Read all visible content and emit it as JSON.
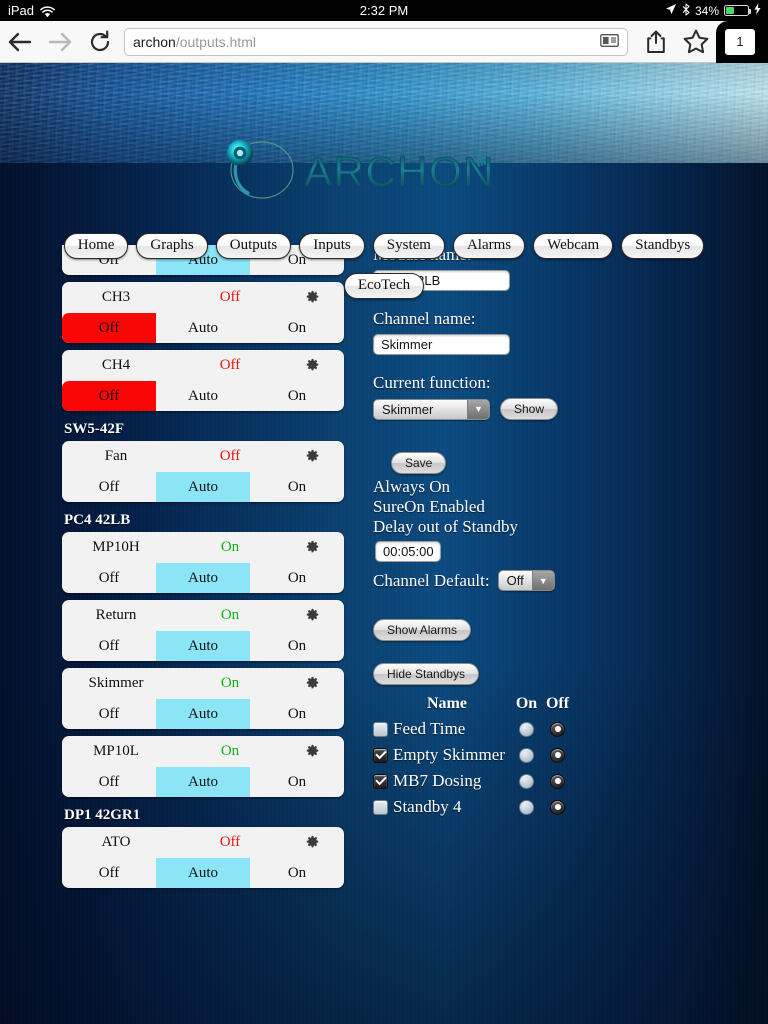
{
  "status_bar": {
    "carrier": "iPad",
    "wifi_icon": "wifi-icon",
    "time": "2:32 PM",
    "location_icon": "location-arrow-icon",
    "bluetooth_icon": "bluetooth-icon",
    "battery_percent": "34%",
    "charging_icon": "lightning-bolt-icon"
  },
  "browser": {
    "back_icon": "back-arrow-icon",
    "forward_icon": "forward-arrow-icon",
    "reload_icon": "reload-icon",
    "url_host": "archon",
    "url_path": "/outputs.html",
    "reader_icon": "reader-view-icon",
    "share_icon": "share-icon",
    "bookmark_icon": "star-icon",
    "tab_count": "1"
  },
  "header": {
    "logo_text": "ARCHON",
    "logo_mark": "archon-circle-logo-icon",
    "signal_icon": "wifi-arc-icon"
  },
  "nav": {
    "row1": [
      {
        "label": "Home",
        "name": "nav-home"
      },
      {
        "label": "Graphs",
        "name": "nav-graphs"
      },
      {
        "label": "Outputs",
        "name": "nav-outputs"
      },
      {
        "label": "Inputs",
        "name": "nav-inputs"
      },
      {
        "label": "System",
        "name": "nav-system"
      },
      {
        "label": "Alarms",
        "name": "nav-alarms"
      },
      {
        "label": "Webcam",
        "name": "nav-webcam"
      },
      {
        "label": "Standbys",
        "name": "nav-standbys"
      }
    ],
    "row2": [
      {
        "label": "EcoTech",
        "name": "nav-ecotech"
      }
    ]
  },
  "outputs": {
    "segment_labels": {
      "off": "Off",
      "auto": "Auto",
      "on": "On"
    },
    "gear_icon": "gear-icon",
    "groups": [
      {
        "label": "",
        "cards": [
          {
            "clipped": true,
            "name": "",
            "state": "",
            "state_class": "",
            "selected": "auto"
          }
        ]
      },
      {
        "label": "",
        "cards": [
          {
            "name": "CH3",
            "state": "Off",
            "state_class": "off",
            "selected": "off"
          },
          {
            "name": "CH4",
            "state": "Off",
            "state_class": "off",
            "selected": "off"
          }
        ]
      },
      {
        "label": "SW5-42F",
        "cards": [
          {
            "name": "Fan",
            "state": "Off",
            "state_class": "off",
            "selected": "auto"
          }
        ]
      },
      {
        "label": "PC4 42LB",
        "cards": [
          {
            "name": "MP10H",
            "state": "On",
            "state_class": "on",
            "selected": "auto"
          },
          {
            "name": "Return",
            "state": "On",
            "state_class": "on",
            "selected": "auto"
          },
          {
            "name": "Skimmer",
            "state": "On",
            "state_class": "on",
            "selected": "auto"
          },
          {
            "name": "MP10L",
            "state": "On",
            "state_class": "on",
            "selected": "auto"
          }
        ]
      },
      {
        "label": "DP1 42GR1",
        "cards": [
          {
            "name": "ATO",
            "state": "Off",
            "state_class": "off",
            "selected": "auto"
          }
        ]
      }
    ]
  },
  "detail": {
    "module_name_label": "Module name:",
    "module_name_value": "PC4 42LB",
    "channel_name_label": "Channel name:",
    "channel_name_value": "Skimmer",
    "current_function_label": "Current function:",
    "current_function_value": "Skimmer",
    "show_button": "Show",
    "save_button": "Save",
    "always_on": "Always On",
    "sureon_enabled": "SureOn Enabled",
    "delay_out_of_standby": "Delay out of Standby",
    "delay_value": "00:05:00",
    "channel_default_label": "Channel Default:",
    "channel_default_value": "Off",
    "show_alarms_button": "Show Alarms",
    "hide_standbys_button": "Hide Standbys"
  },
  "standbys": {
    "headers": {
      "name": "Name",
      "on": "On",
      "off": "Off"
    },
    "rows": [
      {
        "label": "Feed Time",
        "checked": false,
        "state": "off"
      },
      {
        "label": "Empty Skimmer",
        "checked": true,
        "state": "off"
      },
      {
        "label": "MB7 Dosing",
        "checked": true,
        "state": "off"
      },
      {
        "label": "Standby 4",
        "checked": false,
        "state": "off"
      }
    ]
  },
  "colors": {
    "auto_selected": "#8ce4f7",
    "off_selected": "#fb0606",
    "state_on": "#12b312",
    "state_off": "#ee1111",
    "battery_green": "#4cd964"
  }
}
